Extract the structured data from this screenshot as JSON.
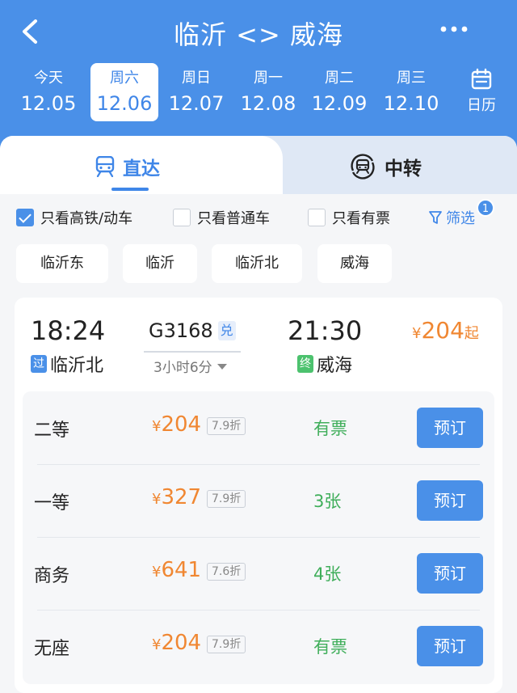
{
  "header": {
    "title": "临沂 <> 威海",
    "dates": [
      {
        "weekday": "今天",
        "date": "12.05"
      },
      {
        "weekday": "周六",
        "date": "12.06",
        "selected": true
      },
      {
        "weekday": "周日",
        "date": "12.07"
      },
      {
        "weekday": "周一",
        "date": "12.08"
      },
      {
        "weekday": "周二",
        "date": "12.09"
      },
      {
        "weekday": "周三",
        "date": "12.10"
      }
    ],
    "calendar_label": "日历"
  },
  "tabs": {
    "direct_label": "直达",
    "transfer_label": "中转"
  },
  "filters": {
    "high_speed_only": {
      "label": "只看高铁/动车",
      "checked": true
    },
    "regular_only": {
      "label": "只看普通车",
      "checked": false
    },
    "available_only": {
      "label": "只看有票",
      "checked": false
    },
    "filter_label": "筛选",
    "filter_count": "1"
  },
  "stations": [
    "临沂东",
    "临沂",
    "临沂北",
    "威海"
  ],
  "train": {
    "depart_time": "18:24",
    "arrive_time": "21:30",
    "number": "G3168",
    "redeem_badge": "兑",
    "duration": "3小时6分",
    "depart_station_tag": "过",
    "depart_station": "临沂北",
    "arrive_station_tag": "终",
    "arrive_station": "威海",
    "min_price_currency": "¥",
    "min_price": "204",
    "min_price_suffix": "起",
    "seats": [
      {
        "name": "二等",
        "currency": "¥",
        "price": "204",
        "discount": "7.9折",
        "availability": "有票",
        "book": "预订"
      },
      {
        "name": "一等",
        "currency": "¥",
        "price": "327",
        "discount": "7.9折",
        "availability": "3张",
        "book": "预订"
      },
      {
        "name": "商务",
        "currency": "¥",
        "price": "641",
        "discount": "7.6折",
        "availability": "4张",
        "book": "预订"
      },
      {
        "name": "无座",
        "currency": "¥",
        "price": "204",
        "discount": "7.9折",
        "availability": "有票",
        "book": "预订"
      }
    ]
  },
  "colors": {
    "primary": "#4a90e8",
    "price": "#f08732",
    "available": "#3fae5a"
  }
}
